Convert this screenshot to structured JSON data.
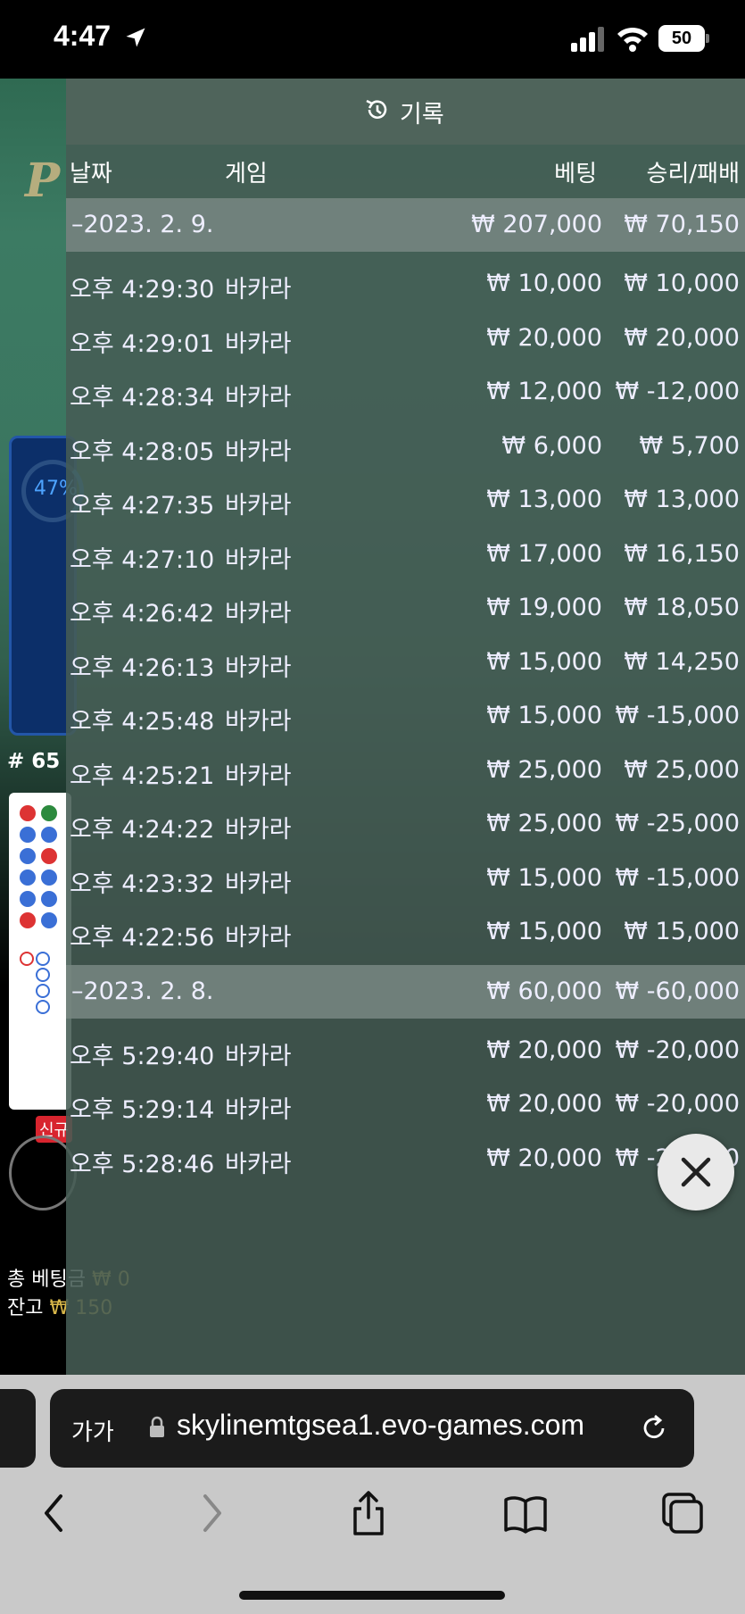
{
  "status_bar": {
    "time": "4:47",
    "battery": "50"
  },
  "game_background": {
    "percent": "47%",
    "round": "# 65",
    "new_badge": "신규",
    "total_bet_label": "총 베팅금",
    "total_bet_value": "₩ 0",
    "balance_label": "잔고",
    "balance_value": "₩ 150"
  },
  "history": {
    "title": "기록",
    "columns": {
      "date": "날짜",
      "game": "게임",
      "bet": "베팅",
      "result": "승리/패배"
    },
    "groups": [
      {
        "date": "–2023. 2. 9.",
        "total_bet": "₩ 207,000",
        "total_result": "₩ 70,150",
        "rows": [
          {
            "time": "오후 4:29:30",
            "game": "바카라",
            "bet": "₩ 10,000",
            "result": "₩ 10,000"
          },
          {
            "time": "오후 4:29:01",
            "game": "바카라",
            "bet": "₩ 20,000",
            "result": "₩ 20,000"
          },
          {
            "time": "오후 4:28:34",
            "game": "바카라",
            "bet": "₩ 12,000",
            "result": "₩ -12,000"
          },
          {
            "time": "오후 4:28:05",
            "game": "바카라",
            "bet": "₩ 6,000",
            "result": "₩ 5,700"
          },
          {
            "time": "오후 4:27:35",
            "game": "바카라",
            "bet": "₩ 13,000",
            "result": "₩ 13,000"
          },
          {
            "time": "오후 4:27:10",
            "game": "바카라",
            "bet": "₩ 17,000",
            "result": "₩ 16,150"
          },
          {
            "time": "오후 4:26:42",
            "game": "바카라",
            "bet": "₩ 19,000",
            "result": "₩ 18,050"
          },
          {
            "time": "오후 4:26:13",
            "game": "바카라",
            "bet": "₩ 15,000",
            "result": "₩ 14,250"
          },
          {
            "time": "오후 4:25:48",
            "game": "바카라",
            "bet": "₩ 15,000",
            "result": "₩ -15,000"
          },
          {
            "time": "오후 4:25:21",
            "game": "바카라",
            "bet": "₩ 25,000",
            "result": "₩ 25,000"
          },
          {
            "time": "오후 4:24:22",
            "game": "바카라",
            "bet": "₩ 25,000",
            "result": "₩ -25,000"
          },
          {
            "time": "오후 4:23:32",
            "game": "바카라",
            "bet": "₩ 15,000",
            "result": "₩ -15,000"
          },
          {
            "time": "오후 4:22:56",
            "game": "바카라",
            "bet": "₩ 15,000",
            "result": "₩ 15,000"
          }
        ]
      },
      {
        "date": "–2023. 2. 8.",
        "total_bet": "₩ 60,000",
        "total_result": "₩ -60,000",
        "rows": [
          {
            "time": "오후 5:29:40",
            "game": "바카라",
            "bet": "₩ 20,000",
            "result": "₩ -20,000"
          },
          {
            "time": "오후 5:29:14",
            "game": "바카라",
            "bet": "₩ 20,000",
            "result": "₩ -20,000"
          },
          {
            "time": "오후 5:28:46",
            "game": "바카라",
            "bet": "₩ 20,000",
            "result": "₩ -20,000"
          }
        ]
      }
    ]
  },
  "browser": {
    "text_size_button": "가가",
    "url": "skylinemtgsea1.evo-games.com"
  },
  "icons": {
    "history": "history-icon",
    "close": "close-icon",
    "lock": "lock-icon",
    "reload": "reload-icon",
    "back": "chevron-left-icon",
    "forward": "chevron-right-icon",
    "share": "share-icon",
    "bookmarks": "book-icon",
    "tabs": "tabs-icon"
  }
}
